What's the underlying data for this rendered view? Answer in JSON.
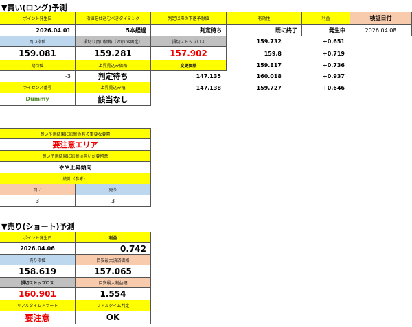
{
  "long": {
    "title": "▼買い(ロング)予測",
    "h_point_date": "ポイント発生日",
    "h_timing": "指値を仕込むべきタイミング",
    "h_lower_forecast": "判定以降の下落予想値",
    "h_validity": "有効性",
    "h_profit": "利益",
    "h_verify_date": "検証日付",
    "point_date": "2026.04.01",
    "timing": "5本経過",
    "lower_forecast_val": "判定待ち",
    "validity_val": "既に終了",
    "profit_status": "発生中",
    "verify_date": "2026.04.08",
    "h_buy_limit": "買い指値",
    "h_no_stop_limit": "損切り買い価格（20pips固定）",
    "h_no_stop": "損切ストップロス",
    "buy_limit": "159.081",
    "no_stop_limit": "159.281",
    "stop_loss": "157.902",
    "h_expected": "期待値",
    "h_upper1": "上昇見込み価格",
    "h_shift": "変更価格",
    "expected": "-3",
    "upper_status": "判定待ち",
    "h_license": "ライセンス番号",
    "h_upper2": "上昇見込み幅",
    "license": "Dummy",
    "upper2_val": "該当なし",
    "rows": [
      {
        "a": "159.732",
        "b": "",
        "c": "+0.651"
      },
      {
        "a": "159.8",
        "b": "",
        "c": "+0.719"
      },
      {
        "a": "159.817",
        "b": "",
        "c": "+0.736"
      },
      {
        "a": "147.135",
        "b": "160.018",
        "c": "+0.937"
      },
      {
        "a": "147.138",
        "b": "159.727",
        "c": "+0.646"
      }
    ]
  },
  "influence": {
    "h_factor": "買い予測結果に影響の有る重要な要素",
    "factor_val": "要注意エリア",
    "h_trend": "買い予測結果に影響は無いが要留意",
    "trend_val": "やや上昇傾向",
    "h_stats": "統計（参考）",
    "h_buy": "買い",
    "h_sell": "売り",
    "buy_count": "3",
    "sell_count": "3"
  },
  "short": {
    "title": "▼売り(ショート)予測",
    "h_point_date": "ポイント発生日",
    "h_profit": "利益",
    "point_date": "2026.04.06",
    "profit": "0.742",
    "h_sell_limit": "売り指値",
    "h_target_low": "目安最大決済価格",
    "sell_limit": "158.619",
    "target_low": "157.065",
    "h_stop": "損切ストップロス",
    "h_max_profit": "目安最大利益幅",
    "stop": "160.901",
    "max_profit": "1.554",
    "h_alert": "リアルタイムアラート",
    "h_judge": "リアルタイム判定",
    "alert": "要注意",
    "judge": "OK"
  },
  "colors": {
    "yellow": "#ffff00",
    "blue": "#bdd7ee",
    "gray": "#c0c0c0",
    "orange": "#f8cbad",
    "red": "#ee0000",
    "green": "#5a8f2e"
  }
}
